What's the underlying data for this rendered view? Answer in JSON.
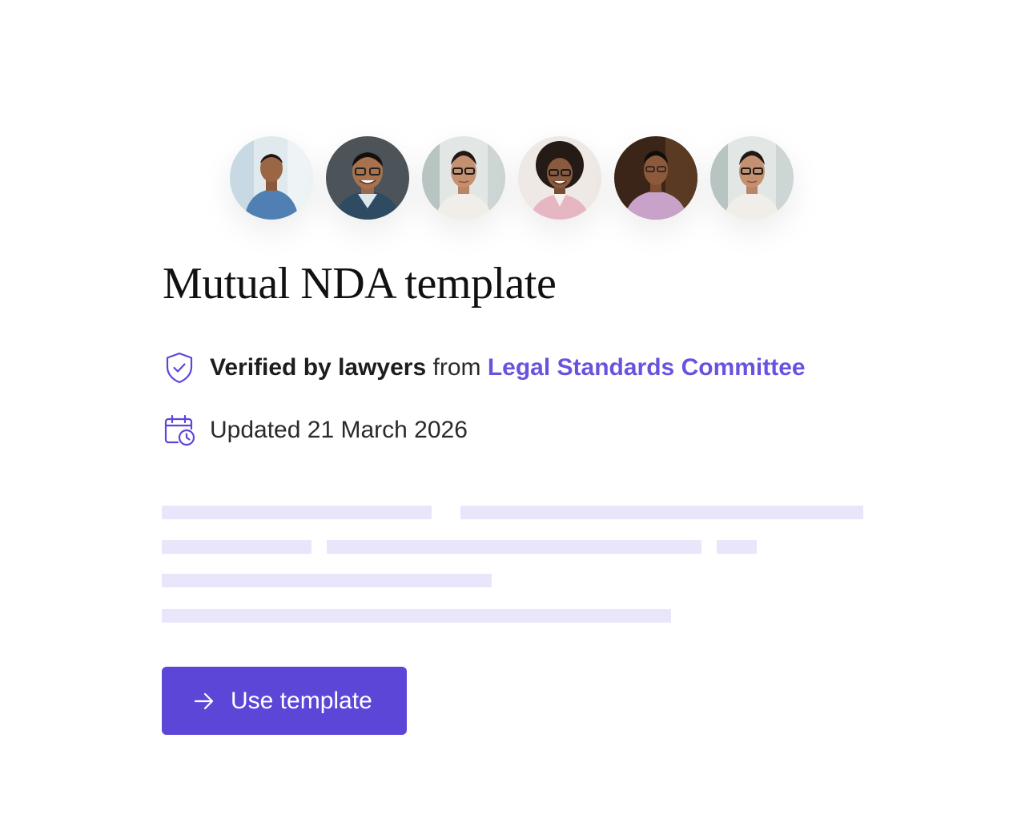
{
  "avatars": [
    {
      "icon": "avatar-photo-man-blue-shirt"
    },
    {
      "icon": "avatar-photo-man-glasses-smiling"
    },
    {
      "icon": "avatar-photo-woman-glasses"
    },
    {
      "icon": "avatar-photo-woman-curly-hair"
    },
    {
      "icon": "avatar-photo-man-lavender-shirt"
    },
    {
      "icon": "avatar-photo-woman-glasses"
    }
  ],
  "template": {
    "title": "Mutual NDA template",
    "verified_label": "Verified by lawyers",
    "verified_connector": "from",
    "verified_source": "Legal Standards Committee",
    "updated_text": "Updated 21 March 2026"
  },
  "icons": {
    "verified": "shield-check-icon",
    "updated": "calendar-clock-icon",
    "cta": "arrow-right-icon"
  },
  "cta": {
    "label": "Use template"
  },
  "colors": {
    "accent": "#5c46d8",
    "link": "#6a52e0",
    "skeleton": "#e9e5fb",
    "text": "#1c1c1c"
  }
}
